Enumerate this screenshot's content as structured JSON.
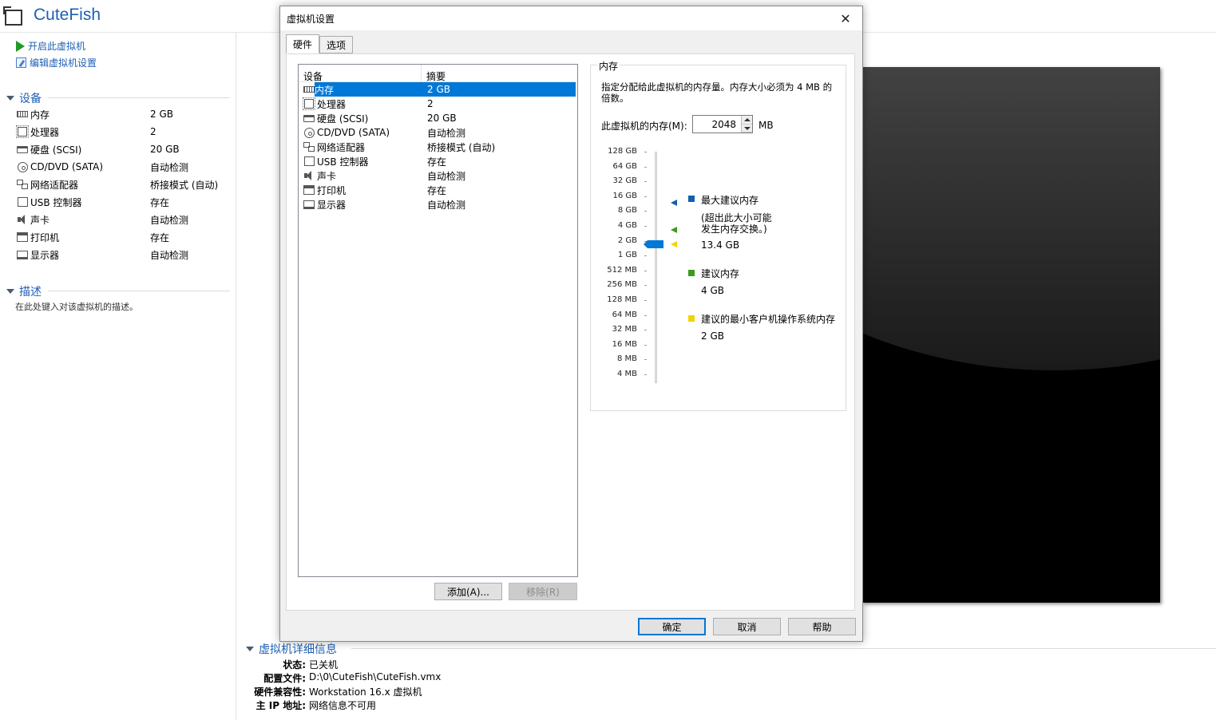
{
  "vm": {
    "name": "CuteFish"
  },
  "actions": {
    "power_on": "开启此虚拟机",
    "edit_settings": "编辑虚拟机设置"
  },
  "sections": {
    "devices": "设备",
    "description": "描述",
    "details": "虚拟机详细信息"
  },
  "devices": [
    {
      "icon": "memory-icon",
      "name": "内存",
      "value": "2 GB"
    },
    {
      "icon": "processor-icon",
      "name": "处理器",
      "value": "2"
    },
    {
      "icon": "hard-disk-icon",
      "name": "硬盘 (SCSI)",
      "value": "20 GB"
    },
    {
      "icon": "cd-dvd-icon",
      "name": "CD/DVD (SATA)",
      "value": "自动检测"
    },
    {
      "icon": "network-adapter-icon",
      "name": "网络适配器",
      "value": "桥接模式 (自动)"
    },
    {
      "icon": "usb-controller-icon",
      "name": "USB 控制器",
      "value": "存在"
    },
    {
      "icon": "sound-card-icon",
      "name": "声卡",
      "value": "自动检测"
    },
    {
      "icon": "printer-icon",
      "name": "打印机",
      "value": "存在"
    },
    {
      "icon": "display-icon",
      "name": "显示器",
      "value": "自动检测"
    }
  ],
  "description_placeholder": "在此处键入对该虚拟机的描述。",
  "details": [
    {
      "key": "状态:",
      "value": "已关机"
    },
    {
      "key": "配置文件:",
      "value": "D:\\0\\CuteFish\\CuteFish.vmx"
    },
    {
      "key": "硬件兼容性:",
      "value": "Workstation 16.x 虚拟机"
    },
    {
      "key": "主 IP 地址:",
      "value": "网络信息不可用"
    }
  ],
  "dialog": {
    "title": "虚拟机设置",
    "close": "✕",
    "tabs": [
      "硬件",
      "选项"
    ],
    "list_headers": {
      "device": "设备",
      "summary": "摘要"
    },
    "selected_index": 0,
    "buttons": {
      "add": "添加(A)...",
      "remove": "移除(R)",
      "ok": "确定",
      "cancel": "取消",
      "help": "帮助"
    },
    "memory": {
      "legend": "内存",
      "description": "指定分配给此虚拟机的内存量。内存大小必须为 4 MB 的倍数。",
      "field_label": "此虚拟机的内存(M):",
      "value": "2048",
      "unit": "MB",
      "scale": [
        "128 GB",
        "64 GB",
        "32 GB",
        "16 GB",
        "8 GB",
        "4 GB",
        "2 GB",
        "1 GB",
        "512 MB",
        "256 MB",
        "128 MB",
        "64 MB",
        "32 MB",
        "16 MB",
        "8 MB",
        "4 MB"
      ],
      "max_recommended": {
        "title": "最大建议内存",
        "note_line1": "(超出此大小可能",
        "note_line2": "发生内存交换。)",
        "value": "13.4 GB",
        "color": "#1060b0"
      },
      "recommended": {
        "title": "建议内存",
        "value": "4 GB",
        "color": "#3c9a1c"
      },
      "min_guest": {
        "title": "建议的最小客户机操作系统内存",
        "value": "2 GB",
        "color": "#f2d200"
      }
    }
  }
}
